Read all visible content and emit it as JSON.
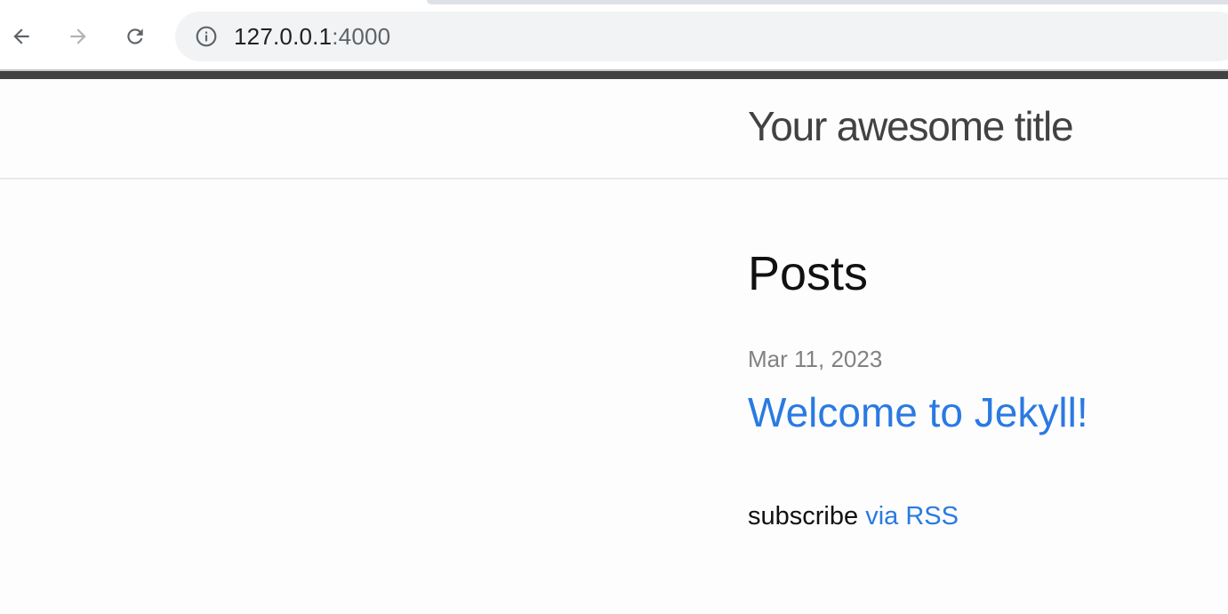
{
  "browser": {
    "url_host": "127.0.0.1",
    "url_port": ":4000",
    "icons": {
      "back": "arrow-left-icon",
      "forward": "arrow-right-icon",
      "reload": "reload-icon",
      "site_info": "info-icon"
    }
  },
  "site": {
    "title": "Your awesome title"
  },
  "main": {
    "heading": "Posts",
    "posts": [
      {
        "date": "Mar 11, 2023",
        "title": "Welcome to Jekyll!"
      }
    ],
    "subscribe_prefix": "subscribe",
    "subscribe_link": "via RSS"
  },
  "colors": {
    "link": "#2a7ae2",
    "header_bar": "#424242",
    "meta": "#828282"
  }
}
